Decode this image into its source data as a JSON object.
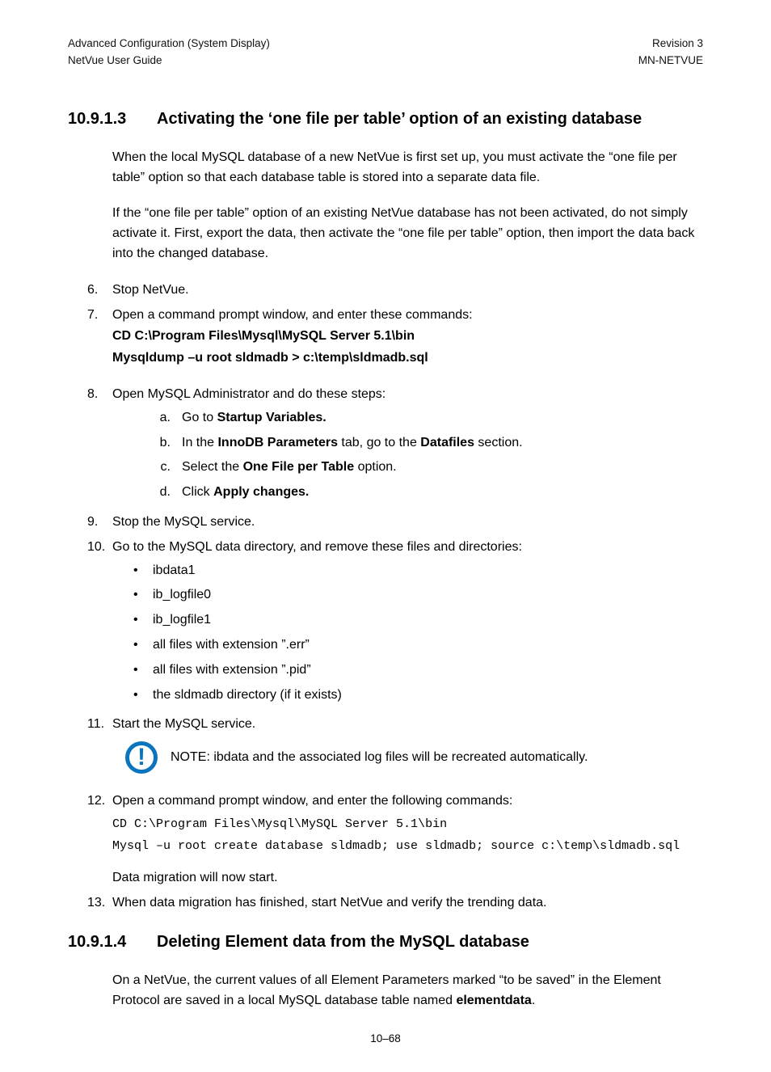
{
  "header": {
    "left1": "Advanced Configuration (System Display)",
    "left2": "NetVue User Guide",
    "right1": "Revision 3",
    "right2": "MN-NETVUE"
  },
  "section1": {
    "num": "10.9.1.3",
    "title": "Activating the ‘one file per table’ option of an existing database",
    "para1": "When the local MySQL database of a new NetVue is first set up, you must activate the “one file per table” option so that each database table is stored into a separate data file.",
    "para2": "If the “one file per table” option of an existing NetVue database has not been activated, do not simply activate it. First, export the data, then activate the “one file per table” option, then import the data back into the changed database."
  },
  "steps": {
    "s6": {
      "mk": "6.",
      "text": "Stop NetVue."
    },
    "s7": {
      "mk": "7.",
      "text": "Open a command prompt window, and enter these commands:",
      "cmd1": "CD C:\\Program Files\\Mysql\\MySQL Server 5.1\\bin",
      "cmd2": "Mysqldump –u root sldmadb > c:\\temp\\sldmadb.sql"
    },
    "s8": {
      "mk": "8.",
      "text": "Open MySQL Administrator and do these steps:",
      "a": {
        "mk": "a.",
        "pre": "Go to ",
        "b": "Startup Variables.",
        "post": ""
      },
      "b": {
        "mk": "b.",
        "pre": "In the ",
        "b1": "InnoDB Parameters",
        "mid": " tab, go to the ",
        "b2": "Datafiles",
        "post": " section."
      },
      "c": {
        "mk": "c.",
        "pre": "Select the ",
        "b": "One File per Table",
        "post": " option."
      },
      "d": {
        "mk": "d.",
        "pre": "Click ",
        "b": "Apply changes.",
        "post": ""
      }
    },
    "s9": {
      "mk": "9.",
      "text": "Stop the MySQL service."
    },
    "s10": {
      "mk": "10.",
      "text": "Go to the MySQL data directory, and remove these files and directories:",
      "items": {
        "i0": "ibdata1",
        "i1": "ib_logfile0",
        "i2": "ib_logfile1",
        "i3": "all files with extension ”.err”",
        "i4": "all files with extension ”.pid”",
        "i5": "the sldmadb directory (if it exists)"
      }
    },
    "s11": {
      "mk": "11.",
      "text": "Start the MySQL service."
    },
    "note": "NOTE:  ibdata and the associated log files will be recreated automatically.",
    "s12": {
      "mk": "12.",
      "text": "Open a command prompt window, and enter the following commands:",
      "code1": "CD C:\\Program Files\\Mysql\\MySQL Server 5.1\\bin",
      "code2": "Mysql –u root create database sldmadb; use sldmadb; source c:\\temp\\sldmadb.sql",
      "after": "Data migration will now start."
    },
    "s13": {
      "mk": "13.",
      "text": "When data migration has finished, start NetVue and verify the trending data."
    }
  },
  "section2": {
    "num": "10.9.1.4",
    "title": "Deleting Element data from the MySQL database",
    "para_pre": "On a NetVue, the current values of all Element Parameters marked “to be saved” in the Element Protocol are saved in a local MySQL database table named ",
    "para_b": "elementdata",
    "para_post": "."
  },
  "footer": "10–68"
}
